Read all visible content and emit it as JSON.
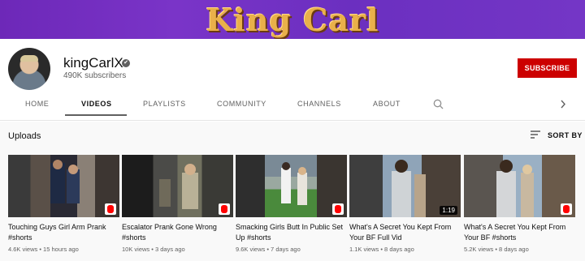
{
  "banner": {
    "title": "King Carl"
  },
  "channel": {
    "name": "kingCarlX",
    "verified_glyph": "✔",
    "subscribers": "490K subscribers",
    "subscribe_label": "SUBSCRIBE"
  },
  "tabs": [
    "HOME",
    "VIDEOS",
    "PLAYLISTS",
    "COMMUNITY",
    "CHANNELS",
    "ABOUT"
  ],
  "active_tab": "VIDEOS",
  "section": {
    "title": "Uploads",
    "sort_label": "SORT BY"
  },
  "videos": [
    {
      "title": "Touching Guys Girl Arm Prank #shorts",
      "meta": "4.6K views • 15 hours ago",
      "badge": "shorts-icon"
    },
    {
      "title": "Escalator Prank Gone Wrong #shorts",
      "meta": "10K views • 3 days ago",
      "badge": "shorts-icon"
    },
    {
      "title": "Smacking Girls Butt In Public Set Up #shorts",
      "meta": "9.6K views • 7 days ago",
      "badge": "shorts-icon"
    },
    {
      "title": "What's A Secret You Kept From Your BF Full Vid",
      "meta": "1.1K views • 8 days ago",
      "duration": "1:19"
    },
    {
      "title": "What's A Secret You Kept From Your BF #shorts",
      "meta": "5.2K views • 8 days ago",
      "badge": "shorts-icon"
    }
  ],
  "icons": {
    "search": "search-icon",
    "next": "chevron-right-icon",
    "sort": "sort-icon"
  },
  "colors": {
    "subscribe": "#cc0000",
    "banner": "#6d28b8",
    "banner_text": "#e9b04a"
  }
}
